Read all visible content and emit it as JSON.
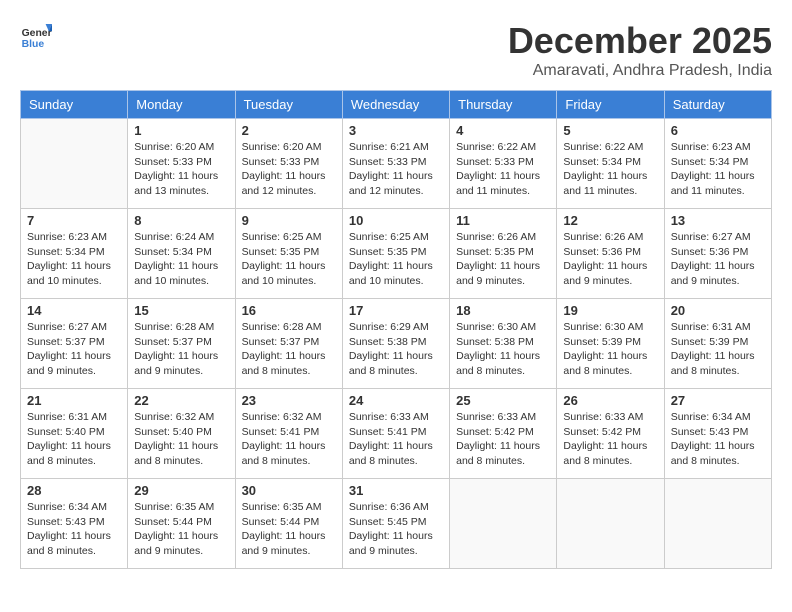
{
  "logo": {
    "line1": "General",
    "line2": "Blue"
  },
  "title": "December 2025",
  "location": "Amaravati, Andhra Pradesh, India",
  "days_of_week": [
    "Sunday",
    "Monday",
    "Tuesday",
    "Wednesday",
    "Thursday",
    "Friday",
    "Saturday"
  ],
  "weeks": [
    [
      {
        "day": "",
        "info": ""
      },
      {
        "day": "1",
        "info": "Sunrise: 6:20 AM\nSunset: 5:33 PM\nDaylight: 11 hours\nand 13 minutes."
      },
      {
        "day": "2",
        "info": "Sunrise: 6:20 AM\nSunset: 5:33 PM\nDaylight: 11 hours\nand 12 minutes."
      },
      {
        "day": "3",
        "info": "Sunrise: 6:21 AM\nSunset: 5:33 PM\nDaylight: 11 hours\nand 12 minutes."
      },
      {
        "day": "4",
        "info": "Sunrise: 6:22 AM\nSunset: 5:33 PM\nDaylight: 11 hours\nand 11 minutes."
      },
      {
        "day": "5",
        "info": "Sunrise: 6:22 AM\nSunset: 5:34 PM\nDaylight: 11 hours\nand 11 minutes."
      },
      {
        "day": "6",
        "info": "Sunrise: 6:23 AM\nSunset: 5:34 PM\nDaylight: 11 hours\nand 11 minutes."
      }
    ],
    [
      {
        "day": "7",
        "info": "Sunrise: 6:23 AM\nSunset: 5:34 PM\nDaylight: 11 hours\nand 10 minutes."
      },
      {
        "day": "8",
        "info": "Sunrise: 6:24 AM\nSunset: 5:34 PM\nDaylight: 11 hours\nand 10 minutes."
      },
      {
        "day": "9",
        "info": "Sunrise: 6:25 AM\nSunset: 5:35 PM\nDaylight: 11 hours\nand 10 minutes."
      },
      {
        "day": "10",
        "info": "Sunrise: 6:25 AM\nSunset: 5:35 PM\nDaylight: 11 hours\nand 10 minutes."
      },
      {
        "day": "11",
        "info": "Sunrise: 6:26 AM\nSunset: 5:35 PM\nDaylight: 11 hours\nand 9 minutes."
      },
      {
        "day": "12",
        "info": "Sunrise: 6:26 AM\nSunset: 5:36 PM\nDaylight: 11 hours\nand 9 minutes."
      },
      {
        "day": "13",
        "info": "Sunrise: 6:27 AM\nSunset: 5:36 PM\nDaylight: 11 hours\nand 9 minutes."
      }
    ],
    [
      {
        "day": "14",
        "info": "Sunrise: 6:27 AM\nSunset: 5:37 PM\nDaylight: 11 hours\nand 9 minutes."
      },
      {
        "day": "15",
        "info": "Sunrise: 6:28 AM\nSunset: 5:37 PM\nDaylight: 11 hours\nand 9 minutes."
      },
      {
        "day": "16",
        "info": "Sunrise: 6:28 AM\nSunset: 5:37 PM\nDaylight: 11 hours\nand 8 minutes."
      },
      {
        "day": "17",
        "info": "Sunrise: 6:29 AM\nSunset: 5:38 PM\nDaylight: 11 hours\nand 8 minutes."
      },
      {
        "day": "18",
        "info": "Sunrise: 6:30 AM\nSunset: 5:38 PM\nDaylight: 11 hours\nand 8 minutes."
      },
      {
        "day": "19",
        "info": "Sunrise: 6:30 AM\nSunset: 5:39 PM\nDaylight: 11 hours\nand 8 minutes."
      },
      {
        "day": "20",
        "info": "Sunrise: 6:31 AM\nSunset: 5:39 PM\nDaylight: 11 hours\nand 8 minutes."
      }
    ],
    [
      {
        "day": "21",
        "info": "Sunrise: 6:31 AM\nSunset: 5:40 PM\nDaylight: 11 hours\nand 8 minutes."
      },
      {
        "day": "22",
        "info": "Sunrise: 6:32 AM\nSunset: 5:40 PM\nDaylight: 11 hours\nand 8 minutes."
      },
      {
        "day": "23",
        "info": "Sunrise: 6:32 AM\nSunset: 5:41 PM\nDaylight: 11 hours\nand 8 minutes."
      },
      {
        "day": "24",
        "info": "Sunrise: 6:33 AM\nSunset: 5:41 PM\nDaylight: 11 hours\nand 8 minutes."
      },
      {
        "day": "25",
        "info": "Sunrise: 6:33 AM\nSunset: 5:42 PM\nDaylight: 11 hours\nand 8 minutes."
      },
      {
        "day": "26",
        "info": "Sunrise: 6:33 AM\nSunset: 5:42 PM\nDaylight: 11 hours\nand 8 minutes."
      },
      {
        "day": "27",
        "info": "Sunrise: 6:34 AM\nSunset: 5:43 PM\nDaylight: 11 hours\nand 8 minutes."
      }
    ],
    [
      {
        "day": "28",
        "info": "Sunrise: 6:34 AM\nSunset: 5:43 PM\nDaylight: 11 hours\nand 8 minutes."
      },
      {
        "day": "29",
        "info": "Sunrise: 6:35 AM\nSunset: 5:44 PM\nDaylight: 11 hours\nand 9 minutes."
      },
      {
        "day": "30",
        "info": "Sunrise: 6:35 AM\nSunset: 5:44 PM\nDaylight: 11 hours\nand 9 minutes."
      },
      {
        "day": "31",
        "info": "Sunrise: 6:36 AM\nSunset: 5:45 PM\nDaylight: 11 hours\nand 9 minutes."
      },
      {
        "day": "",
        "info": ""
      },
      {
        "day": "",
        "info": ""
      },
      {
        "day": "",
        "info": ""
      }
    ]
  ]
}
